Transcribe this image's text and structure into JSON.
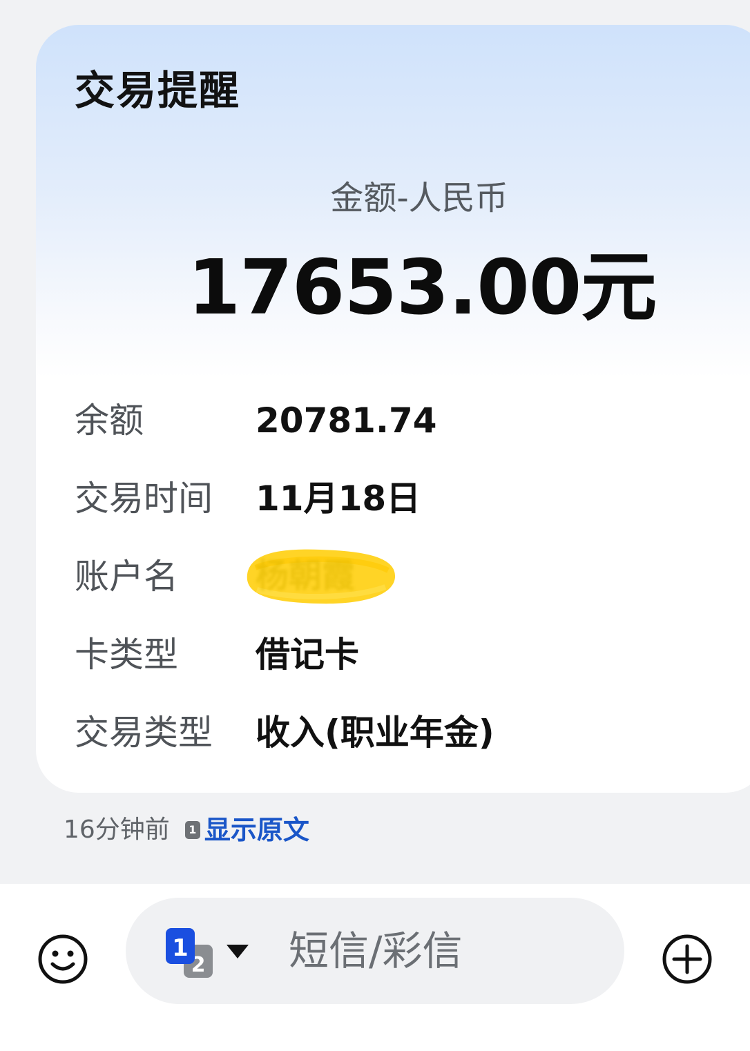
{
  "card": {
    "title": "交易提醒",
    "amount_label": "金额-人民币",
    "amount_value": "17653.00元",
    "rows": [
      {
        "key": "余额",
        "value": "20781.74"
      },
      {
        "key": "交易时间",
        "value": "11月18日"
      },
      {
        "key": "账户名",
        "value": "杨朝霞",
        "redacted": true
      },
      {
        "key": "卡类型",
        "value": "借记卡"
      },
      {
        "key": "交易类型",
        "value": "收入(职业年金)"
      }
    ]
  },
  "meta": {
    "time": "16分钟前",
    "sim_badge": "1",
    "show_original": "显示原文"
  },
  "composer": {
    "emoji_icon": "smiley-icon",
    "sim_primary": "1",
    "sim_secondary": "2",
    "placeholder": "短信/彩信",
    "add_icon": "plus-circle-icon"
  },
  "colors": {
    "link": "#1a56c8",
    "highlight": "#ffd21a",
    "sim_blue": "#1a4fe0",
    "card_gradient_top": "#cfe2fb"
  }
}
